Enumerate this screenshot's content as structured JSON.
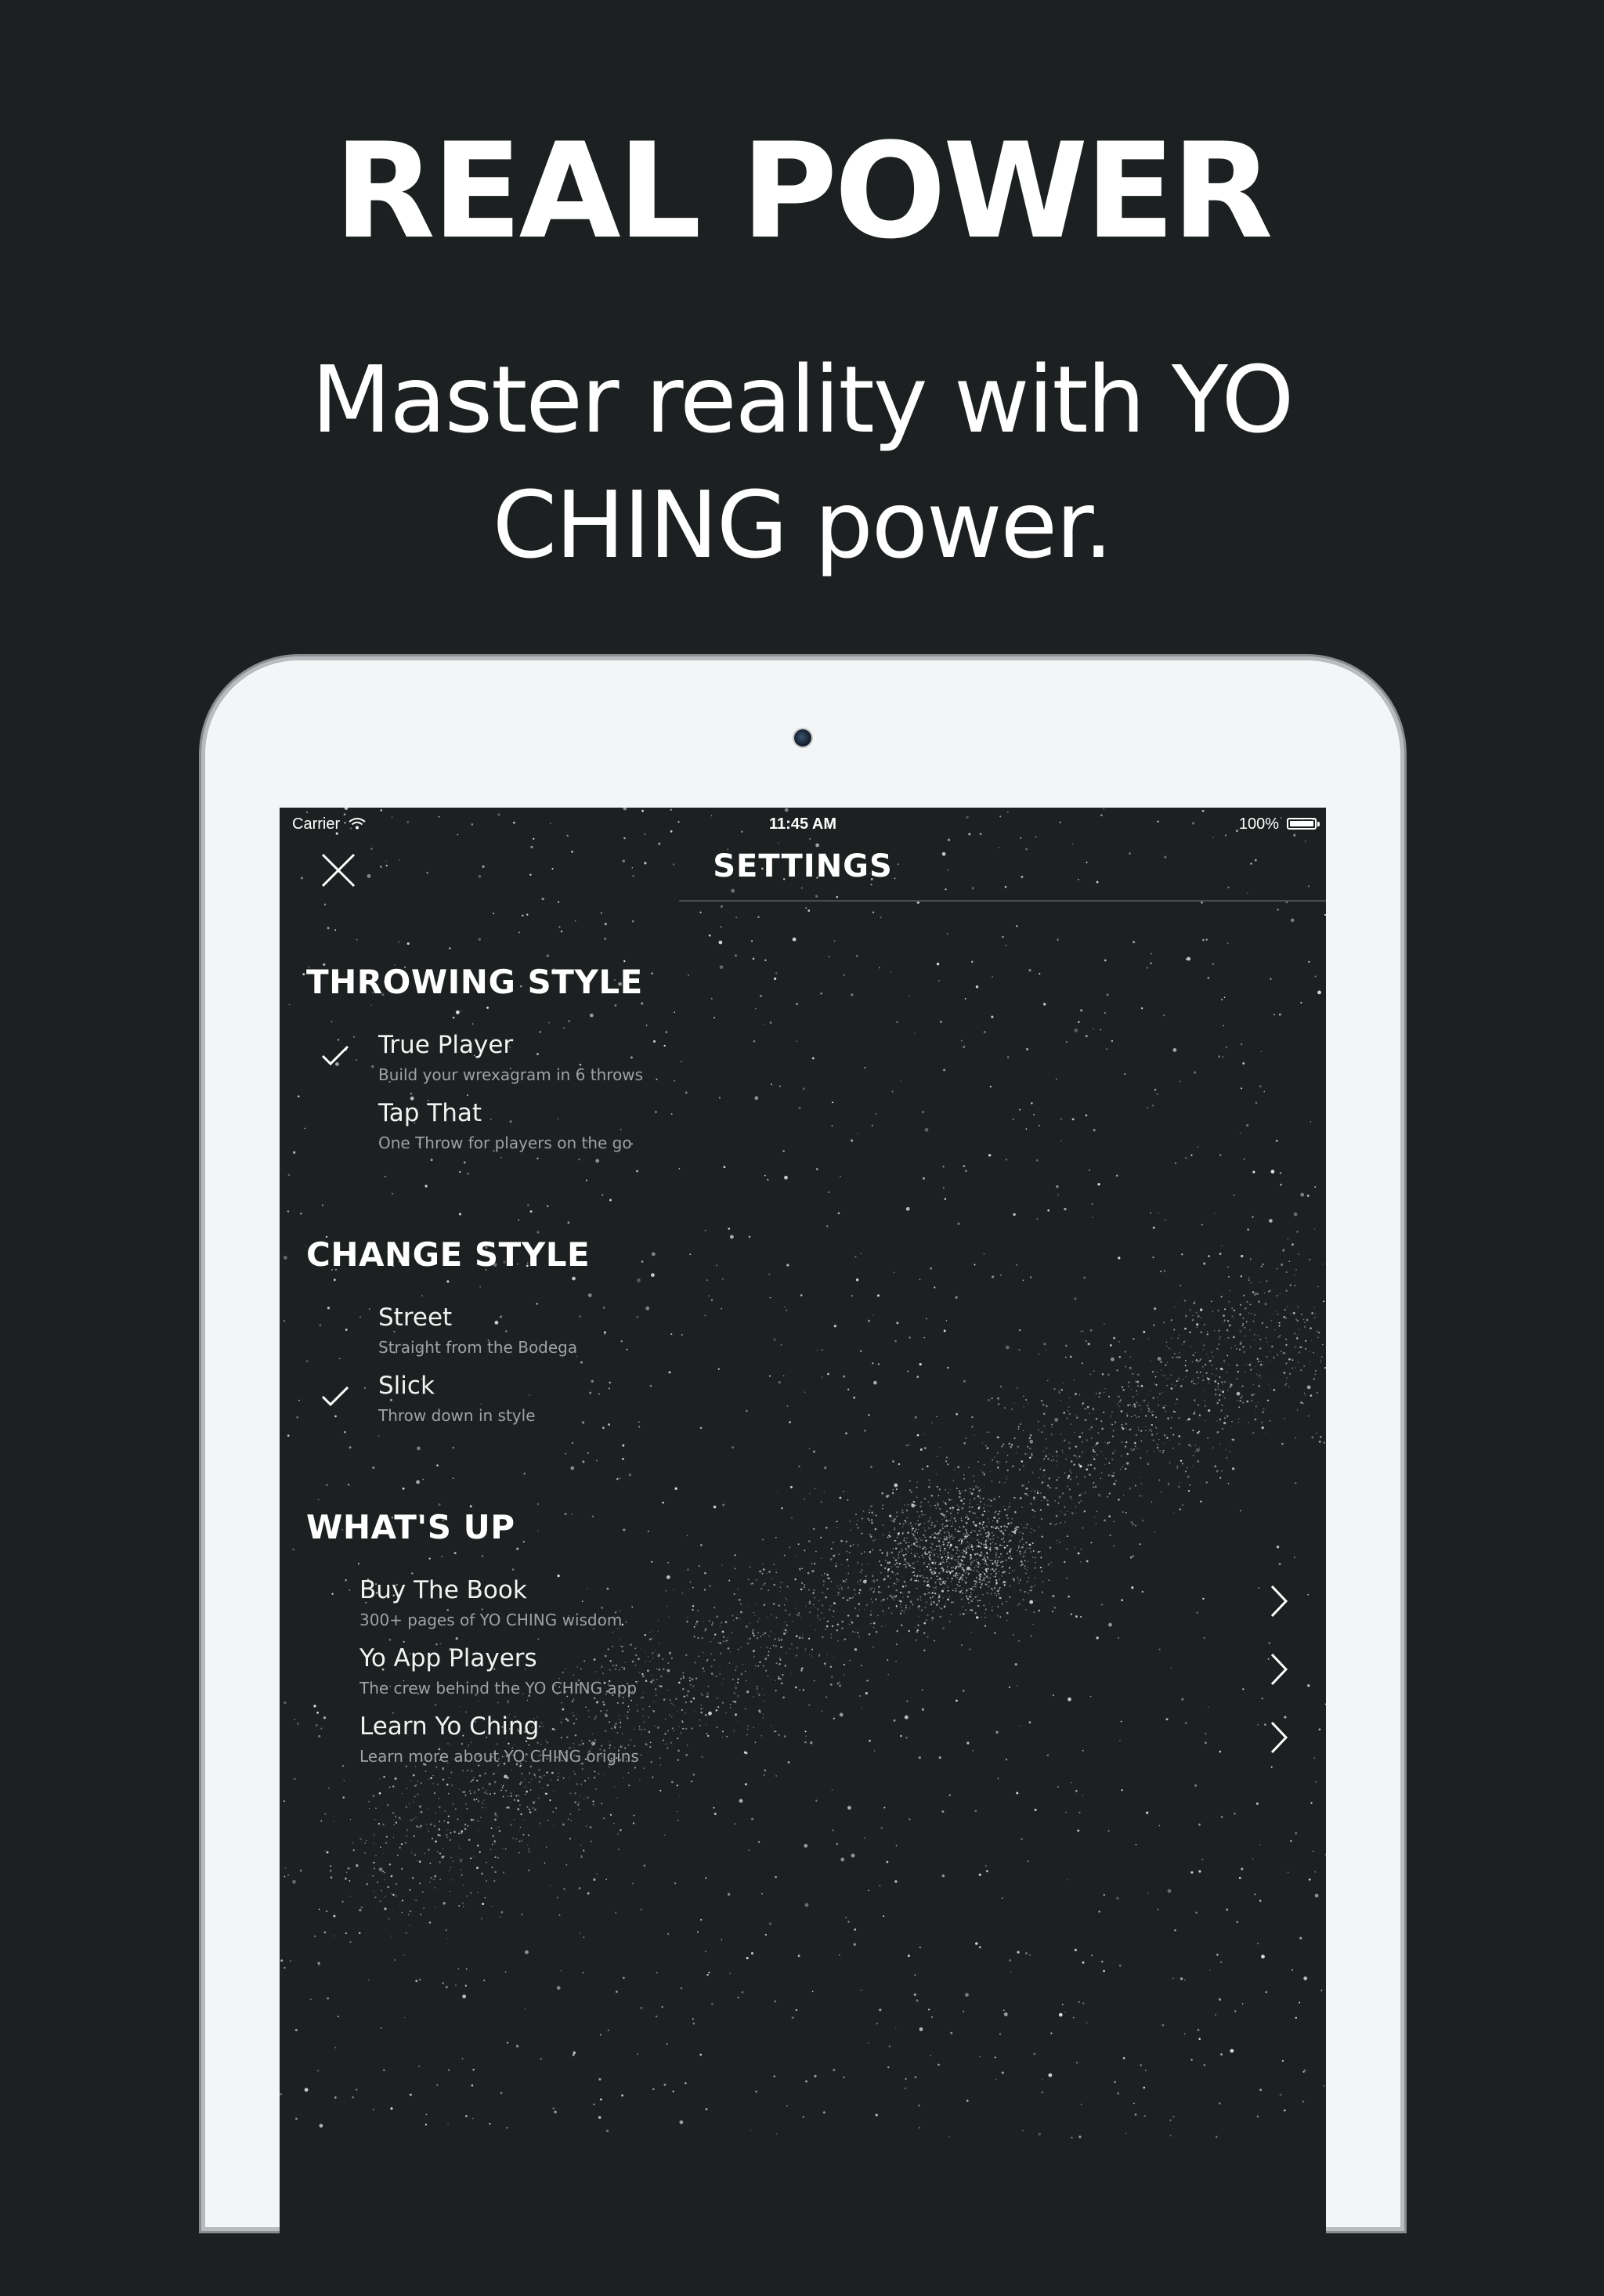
{
  "hero": {
    "title": "REAL POWER",
    "subtitle": "Master reality with YO CHING power."
  },
  "status_bar": {
    "carrier": "Carrier",
    "time": "11:45 AM",
    "battery": "100%",
    "icons": [
      "wifi-icon",
      "battery-icon"
    ]
  },
  "nav": {
    "title": "SETTINGS",
    "close_icon": "close-icon"
  },
  "throwing_style": {
    "heading": "THROWING STYLE",
    "options": [
      {
        "title": "True Player",
        "subtitle": "Build your wrexagram in 6 throws",
        "selected": true
      },
      {
        "title": "Tap That",
        "subtitle": "One Throw for players on the go",
        "selected": false
      }
    ]
  },
  "change_style": {
    "heading": "CHANGE STYLE",
    "options": [
      {
        "title": "Street",
        "subtitle": "Straight from the Bodega",
        "selected": false
      },
      {
        "title": "Slick",
        "subtitle": "Throw down in style",
        "selected": true
      }
    ]
  },
  "whats_up": {
    "heading": "WHAT'S UP",
    "links": [
      {
        "title": "Buy The Book",
        "subtitle": "300+ pages of YO CHING wisdom"
      },
      {
        "title": "Yo App Players",
        "subtitle": "The crew behind the YO CHING app"
      },
      {
        "title": "Learn Yo Ching",
        "subtitle": "Learn more about YO CHING origins"
      }
    ]
  },
  "colors": {
    "background": "#1c2021",
    "device_frame": "#f4f5f7",
    "text_primary": "#ffffff",
    "text_secondary": "#9ea2a6"
  }
}
